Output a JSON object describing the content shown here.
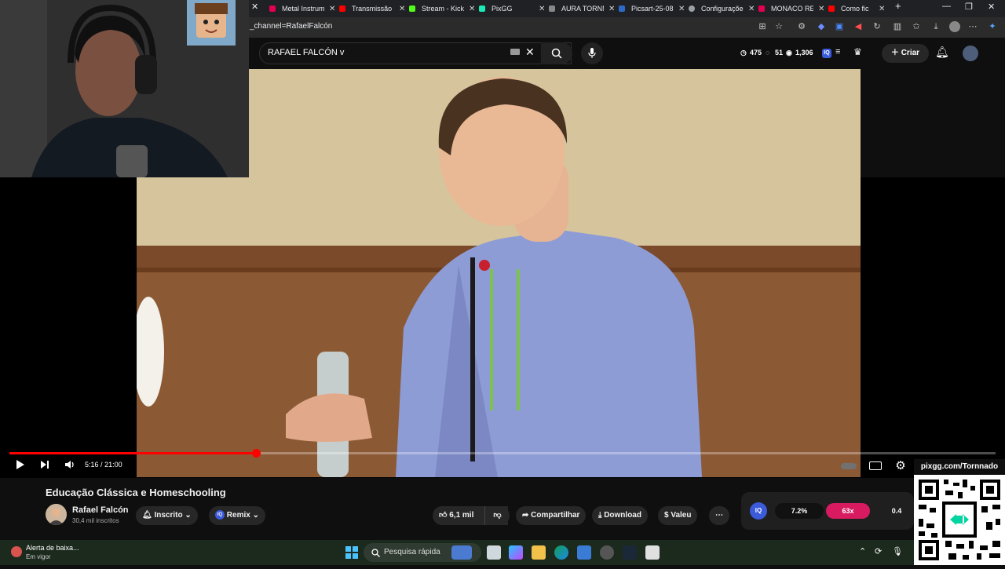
{
  "browser": {
    "tabs": [
      {
        "label": "Metal Instrum",
        "favicon_color": "#e5004f"
      },
      {
        "label": "Transmissão ao",
        "favicon_color": "#ff0000"
      },
      {
        "label": "Stream - Kick",
        "favicon_color": "#53fc18"
      },
      {
        "label": "PixGG",
        "favicon_color": "#1de9b6"
      },
      {
        "label": "AURA TORNM",
        "favicon_color": "#888888"
      },
      {
        "label": "Picsart-25-08",
        "favicon_color": "#2d6ac9"
      },
      {
        "label": "Configurações",
        "favicon_color": "#9aa0a6"
      },
      {
        "label": "MONACO RE",
        "favicon_color": "#e5004f"
      },
      {
        "label": "Como fic",
        "favicon_color": "#ff0000"
      }
    ],
    "url": "_channel=RafaelFalcón"
  },
  "youtube": {
    "search_query": "RAFAEL FALCÓN v",
    "stats": {
      "clock": "475",
      "comments": "51",
      "views": "1,306"
    },
    "create_label": "Criar",
    "player": {
      "time_current": "5:16",
      "time_sep": "/",
      "time_total": "21:00",
      "progress": 0.25
    },
    "video_title": "Educação Clássica e Homeschooling",
    "channel": {
      "name": "Rafael Falcón",
      "subscribers": "30,4 mil inscritos"
    },
    "subscribe_label": "Inscrito",
    "remix_label": "Remix",
    "likes": "6,1 mil",
    "share_label": "Compartilhar",
    "download_label": "Download",
    "thanks_label": "Valeu",
    "iq": {
      "badge": "IQ",
      "v1": "7.2%",
      "v2": "63x",
      "v3": "0.4"
    }
  },
  "overlay": {
    "pixgg_url": "pixgg.com/Tornnado"
  },
  "taskbar": {
    "alert_title": "Alerta de baixa...",
    "alert_sub": "Em vigor",
    "search_placeholder": "Pesquisa rápida"
  },
  "colors": {
    "accent": "#ff0000",
    "iq_blue": "#3b5bdb",
    "iq_pink": "#d81b60"
  }
}
